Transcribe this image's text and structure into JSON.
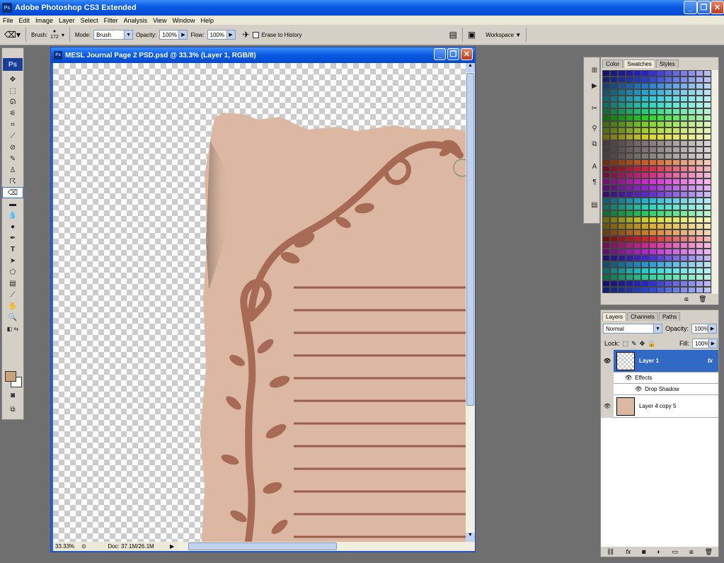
{
  "app": {
    "title": "Adobe Photoshop CS3 Extended",
    "logo": "Ps"
  },
  "menu": [
    "File",
    "Edit",
    "Image",
    "Layer",
    "Select",
    "Filter",
    "Analysis",
    "View",
    "Window",
    "Help"
  ],
  "options": {
    "brush_label": "Brush:",
    "brush_size": "172",
    "mode_label": "Mode:",
    "mode_value": "Brush",
    "opacity_label": "Opacity:",
    "opacity_value": "100%",
    "flow_label": "Flow:",
    "flow_value": "100%",
    "erase_history": "Erase to History",
    "workspace": "Workspace"
  },
  "document": {
    "title": "MESL Journal Page 2 PSD.psd @ 33.3% (Layer 1, RGB/8)",
    "zoom": "33.33%",
    "doc_size": "Doc: 37.1M/26.1M"
  },
  "swatches": {
    "tabs": [
      "Color",
      "Swatches",
      "Styles"
    ],
    "active": "Swatches"
  },
  "layers": {
    "tabs": [
      "Layers",
      "Channels",
      "Paths"
    ],
    "blend": "Normal",
    "opacity_label": "Opacity:",
    "opacity": "100%",
    "lock_label": "Lock:",
    "fill_label": "Fill:",
    "fill": "100%",
    "items": [
      {
        "name": "Layer 1",
        "fx": "fx"
      },
      {
        "name": "Effects"
      },
      {
        "name": "Drop Shadow"
      },
      {
        "name": "Layer 4 copy 5"
      }
    ]
  },
  "colors": {
    "paper": "#dcb8a2",
    "vine": "#a66a55",
    "line": "#9a5e4c",
    "foreground": "#c9a37a",
    "accent": "#316ac5"
  }
}
